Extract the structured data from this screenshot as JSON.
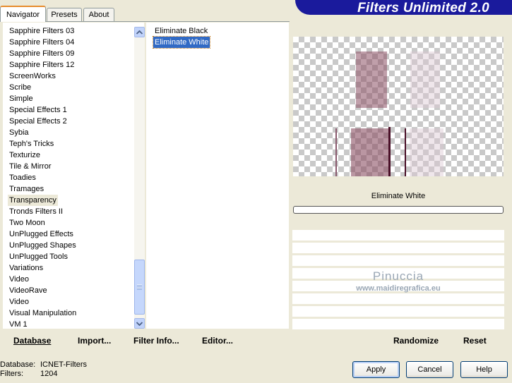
{
  "tabs": [
    {
      "label": "Navigator",
      "active": true
    },
    {
      "label": "Presets",
      "active": false
    },
    {
      "label": "About",
      "active": false
    }
  ],
  "banner": {
    "title": "Filters Unlimited 2.0"
  },
  "categories": {
    "items": [
      "Sapphire Filters 03",
      "Sapphire Filters 04",
      "Sapphire Filters 09",
      "Sapphire Filters 12",
      "ScreenWorks",
      "Scribe",
      "Simple",
      "Special Effects 1",
      "Special Effects 2",
      "Sybia",
      "Teph's Tricks",
      "Texturize",
      "Tile & Mirror",
      "Toadies",
      "Tramages",
      "Transparency",
      "Tronds Filters II",
      "Two Moon",
      "UnPlugged Effects",
      "UnPlugged Shapes",
      "UnPlugged Tools",
      "Variations",
      "Video",
      "VideoRave",
      "Video",
      "Visual Manipulation",
      "VM 1"
    ],
    "selected": "Transparency"
  },
  "filters": {
    "items": [
      "Eliminate Black",
      "Eliminate White"
    ],
    "selected": "Eliminate White"
  },
  "bottom_buttons": {
    "database": "Database",
    "import": "Import...",
    "filter_info": "Filter Info...",
    "editor": "Editor...",
    "randomize": "Randomize",
    "reset": "Reset"
  },
  "control": {
    "filter_name": "Eliminate White",
    "progress": 0
  },
  "watermark": {
    "main": "Pinuccia",
    "sub": "www.maidiregrafica.eu"
  },
  "status": {
    "database_label": "Database:",
    "database_value": "ICNET-Filters",
    "filters_label": "Filters:",
    "filters_value": "1204"
  },
  "dialog_buttons": {
    "apply": "Apply",
    "cancel": "Cancel",
    "help": "Help"
  },
  "colors": {
    "accent": "#316ac5",
    "banner": "#1a1a9c",
    "preview_shape": "#a07888",
    "preview_line": "#5a1a35"
  },
  "icons": {
    "scroll_up": "chevron-up-icon",
    "scroll_down": "chevron-down-icon"
  }
}
